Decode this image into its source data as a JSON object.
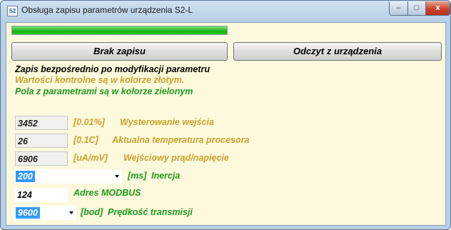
{
  "window": {
    "title": "Obsługa zapisu parametrów urządzenia S2-L",
    "icon_text": "S2"
  },
  "controls": {
    "minimize": "–",
    "maximize": "□",
    "close": "x"
  },
  "progress": {
    "value_percent": 100
  },
  "buttons": {
    "left": "Brak zapisu",
    "right": "Odczyt z urządzenia"
  },
  "info": {
    "line1": "Zapis bezpośrednio po modyfikacji parametru",
    "line2": "Wartości kontrolne są w kolorze złotym.",
    "line3": "Pola z parametrami są w kolorze zielonym"
  },
  "params": [
    {
      "value": "3452",
      "unit": "[0.01%]",
      "name": "Wysterowanie wejścia"
    },
    {
      "value": "26",
      "unit": "[0.1C]",
      "name": "Aktualna temperatura procesora"
    },
    {
      "value": "6906",
      "unit": "[uA/mV]",
      "name": "Wejściowy prąd/napięcie"
    },
    {
      "value": "200",
      "unit": "[ms]",
      "name": "Inercja"
    },
    {
      "value": "124",
      "unit": "",
      "name": "Adres MODBUS"
    },
    {
      "value": "9600",
      "unit": "[bod]",
      "name": "Prędkość transmisji"
    }
  ],
  "colors": {
    "gold": "#caa12c",
    "green": "#1f9a1f",
    "selection": "#3399ff"
  }
}
